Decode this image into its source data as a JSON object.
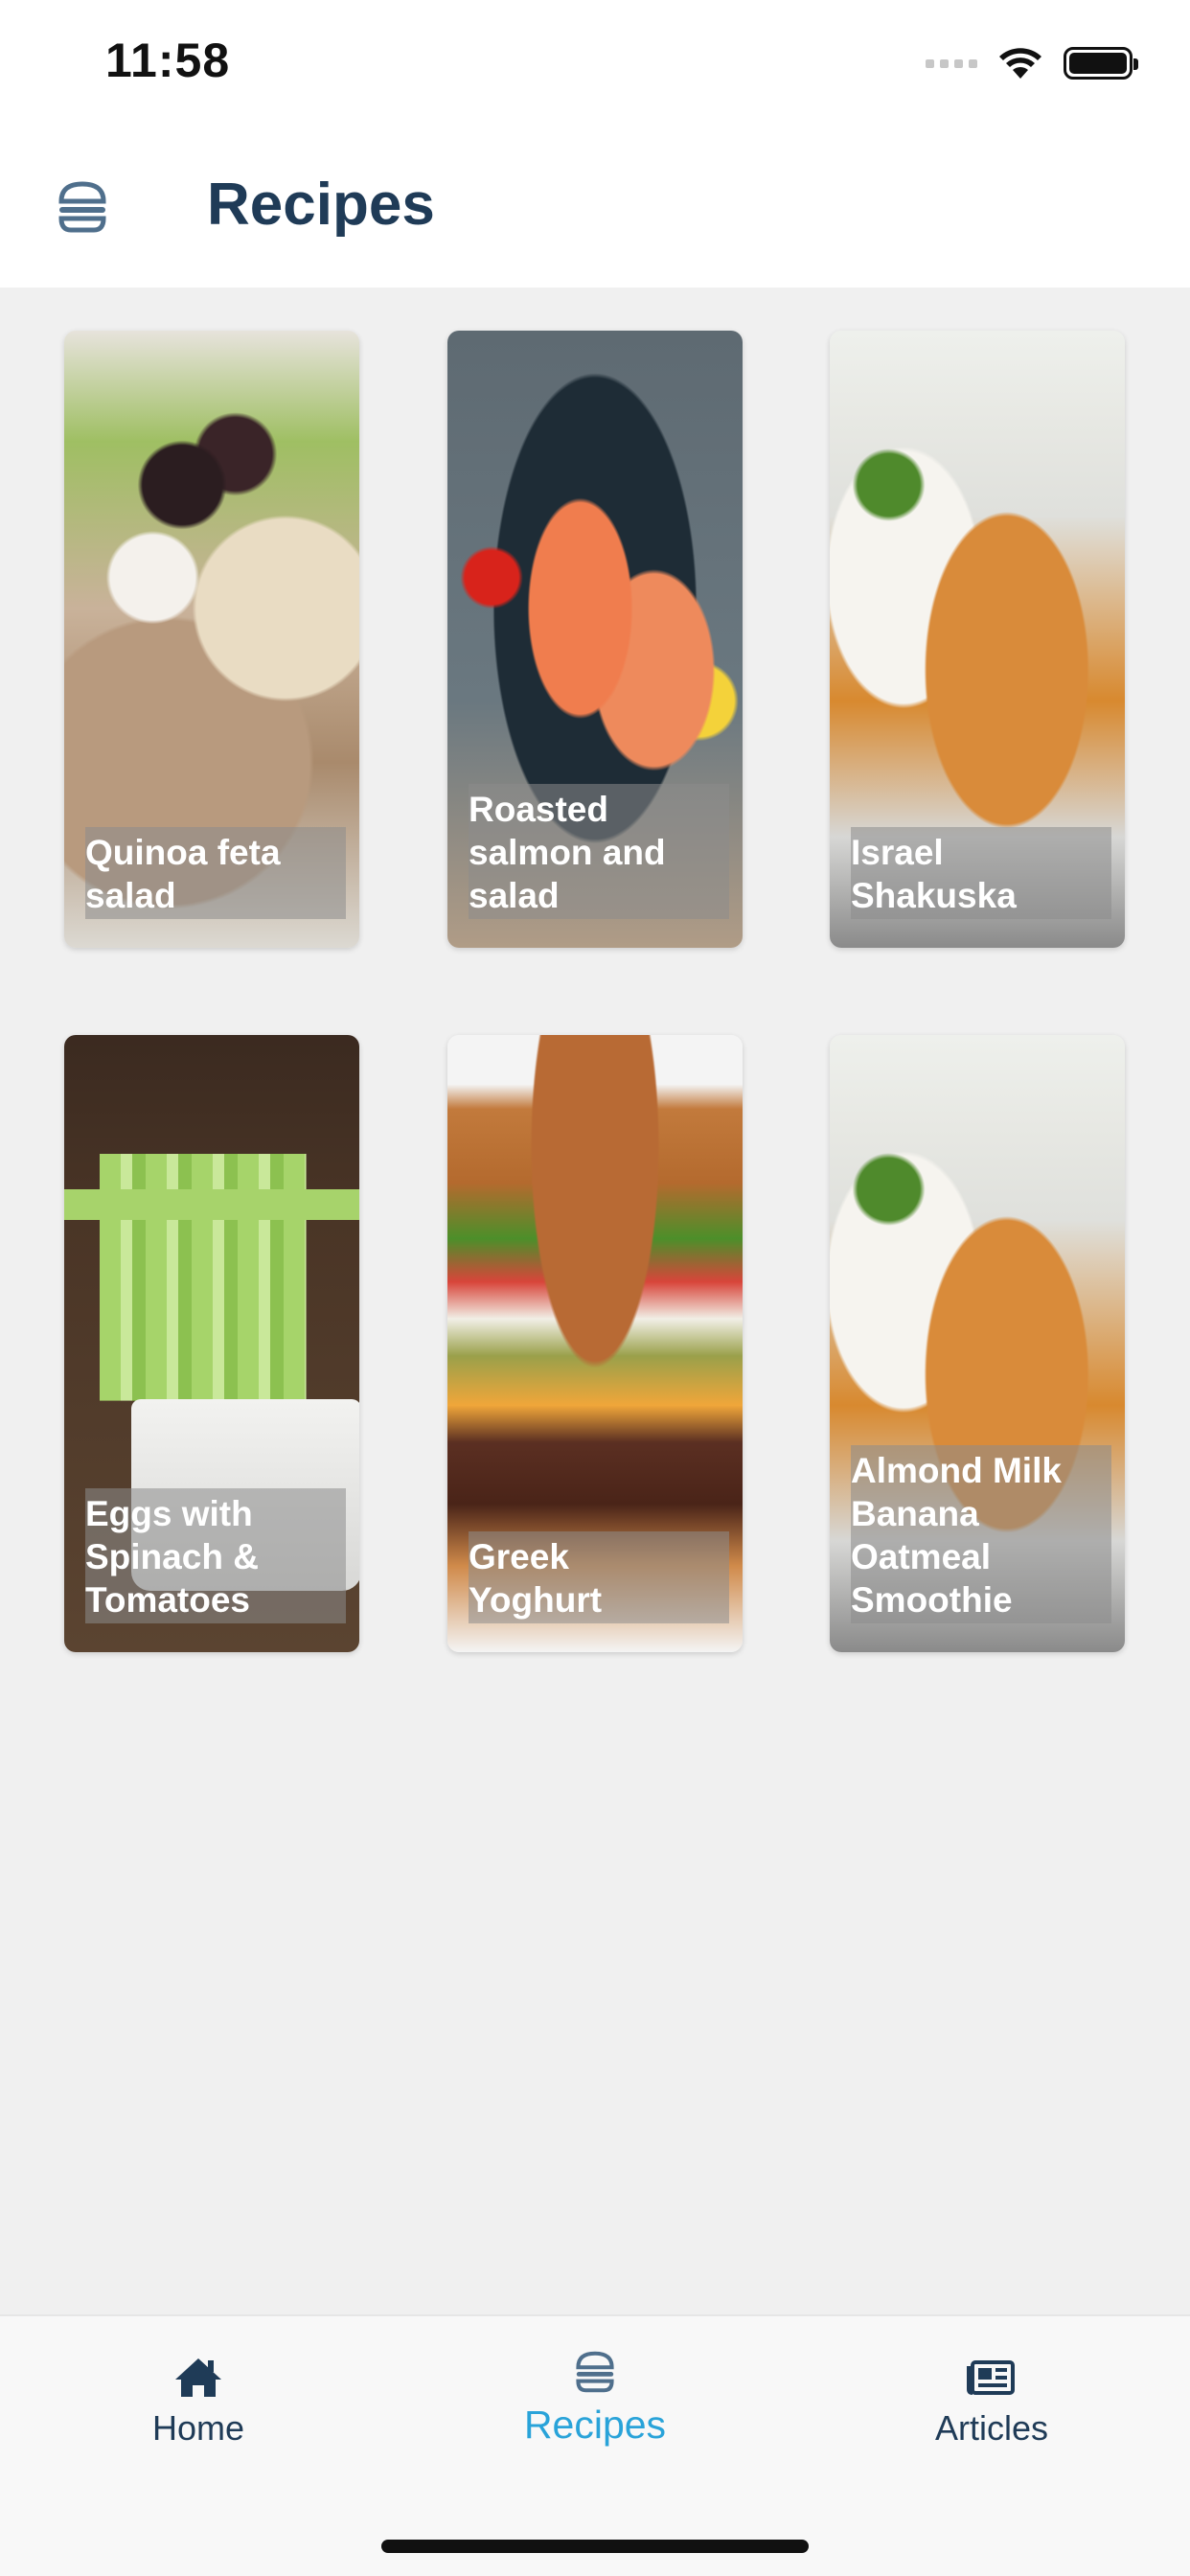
{
  "status_bar": {
    "time": "11:58"
  },
  "header": {
    "title": "Recipes",
    "icon": "burger-icon"
  },
  "recipes": [
    {
      "title": "Quinoa feta\nsalad"
    },
    {
      "title": "Roasted\nsalmon and\nsalad"
    },
    {
      "title": "Israel\nShakuska"
    },
    {
      "title": "Eggs with\nSpinach &\nTomatoes"
    },
    {
      "title": "Greek\nYoghurt"
    },
    {
      "title": "Almond Milk\nBanana\nOatmeal\nSmoothie"
    }
  ],
  "tab_bar": {
    "tabs": [
      {
        "label": "Home",
        "icon": "home-icon",
        "active": false
      },
      {
        "label": "Recipes",
        "icon": "burger-icon",
        "active": true
      },
      {
        "label": "Articles",
        "icon": "newspaper-icon",
        "active": false
      }
    ]
  },
  "colors": {
    "accent": "#29a3d9",
    "text": "#1f3b57",
    "background": "#f0f0f0"
  }
}
